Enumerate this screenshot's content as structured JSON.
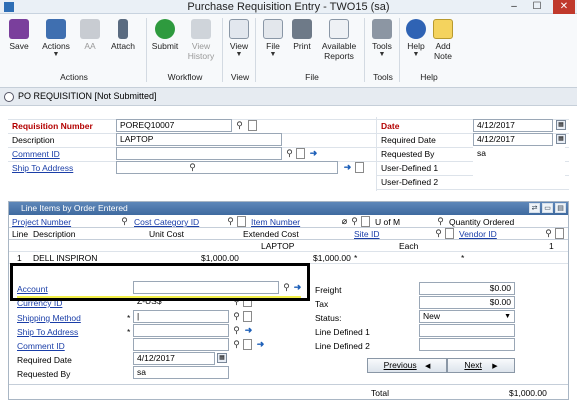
{
  "window": {
    "title": "Purchase Requisition Entry  -  TWO15 (sa)",
    "minimize": "–",
    "restore": "☐",
    "close": "✕"
  },
  "ribbon": {
    "buttons": {
      "save": "Save",
      "actions": "Actions",
      "aa": "AA",
      "attach": "Attach",
      "submit": "Submit",
      "view_history": "View History",
      "view": "View",
      "file": "File",
      "print": "Print",
      "available_reports": "Available Reports",
      "tools": "Tools",
      "help": "Help",
      "add_note": "Add Note"
    },
    "groups": {
      "actions": "Actions",
      "workflow": "Workflow",
      "view": "View",
      "file": "File",
      "tools": "Tools",
      "help": "Help"
    }
  },
  "doc_strip": "PO REQUISITION [Not Submitted]",
  "header": {
    "requisition_number_label": "Requisition Number",
    "requisition_number": "POREQ10007",
    "description_label": "Description",
    "description": "LAPTOP",
    "comment_id_label": "Comment ID",
    "comment_id": "",
    "ship_to_label": "Ship To Address",
    "ship_to": "",
    "date_label": "Date",
    "date": "4/12/2017",
    "required_date_label": "Required Date",
    "required_date": "4/12/2017",
    "requested_by_label": "Requested By",
    "requested_by": "sa",
    "user_defined_1_label": "User-Defined 1",
    "user_defined_1": "",
    "user_defined_2_label": "User-Defined 2",
    "user_defined_2": ""
  },
  "lines": {
    "title": "Line Items by Order Entered",
    "cols": {
      "project_number": "Project Number",
      "cost_category_id": "Cost Category ID",
      "item_number": "Item Number",
      "u_of_m": "U of M",
      "quantity_ordered": "Quantity Ordered",
      "line": "Line",
      "description": "Description",
      "unit_cost": "Unit Cost",
      "extended_cost": "Extended Cost",
      "site_id": "Site ID",
      "vendor_id": "Vendor ID"
    },
    "row1": {
      "item": "LAPTOP",
      "uofm": "Each",
      "qty": "1",
      "line": "1",
      "desc": "DELL INSPIRON",
      "unit_cost": "$1,000.00",
      "ext_cost": "$1,000.00",
      "site": "*",
      "vendor": "*"
    },
    "detail": {
      "account_label": "Account",
      "account": "",
      "currency_label": "Currency ID",
      "currency": "Z-US$",
      "shipping_method_label": "Shipping Method",
      "shipping_method": "|",
      "ship_to_label": "Ship To Address",
      "ship_to": "",
      "comment_label": "Comment ID",
      "comment": "",
      "required_date_label": "Required Date",
      "required_date": "4/12/2017",
      "requested_by_label": "Requested By",
      "requested_by": "sa",
      "freight_label": "Freight",
      "freight": "$0.00",
      "tax_label": "Tax",
      "tax": "$0.00",
      "status_label": "Status:",
      "status": "New",
      "line_defined_1_label": "Line Defined 1",
      "line_defined_2_label": "Line Defined 2",
      "previous": "Previous",
      "next": "Next",
      "total_label": "Total",
      "total": "$1,000.00"
    }
  }
}
